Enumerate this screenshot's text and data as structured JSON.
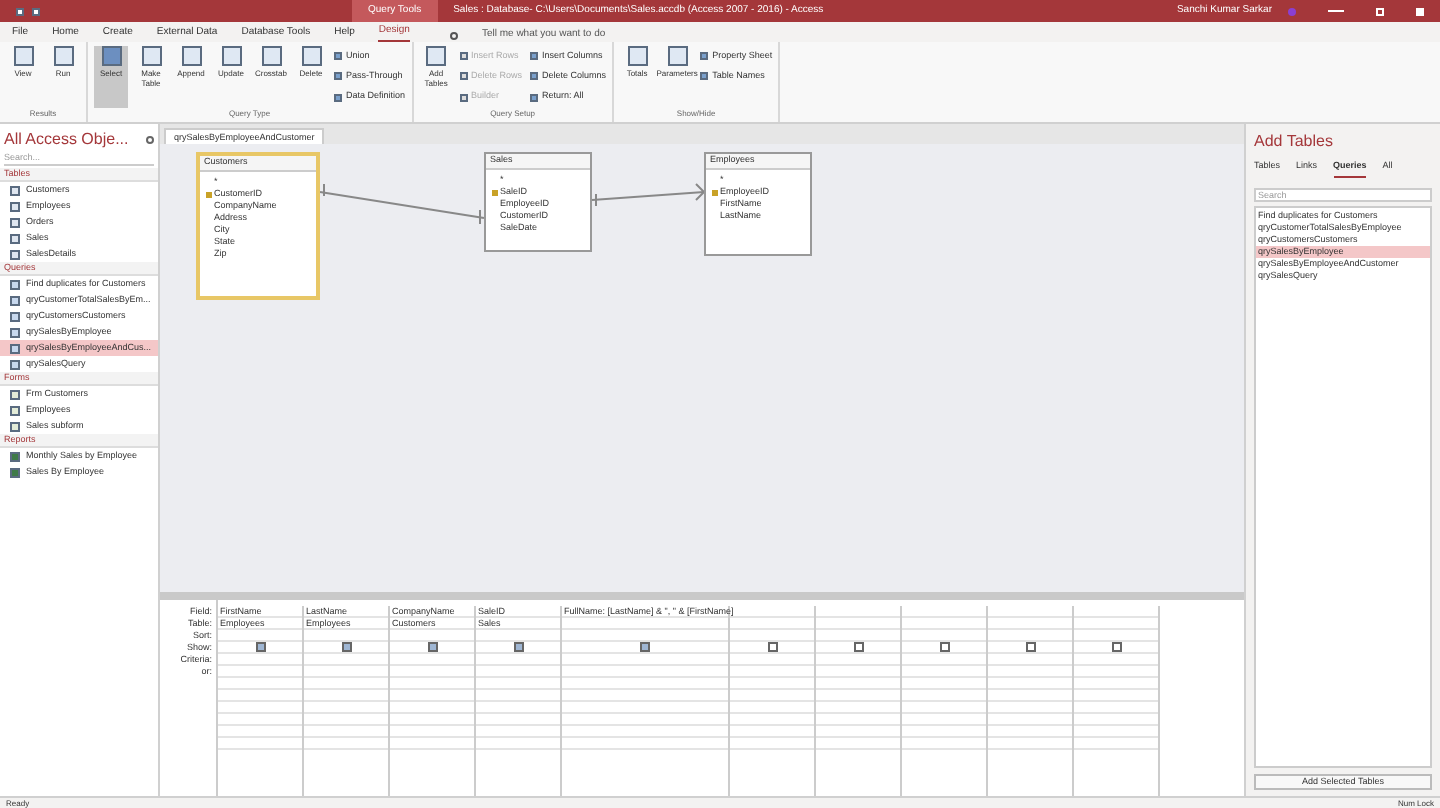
{
  "title_bar": {
    "context": "Query Tools",
    "title": "Sales : Database- C:\\Users\\Documents\\Sales.accdb (Access 2007 - 2016) - Access",
    "user": "Sanchi Kumar Sarkar"
  },
  "ribbon_tabs": [
    {
      "label": "File",
      "selected": false
    },
    {
      "label": "Home",
      "selected": false
    },
    {
      "label": "Create",
      "selected": false
    },
    {
      "label": "External Data",
      "selected": false
    },
    {
      "label": "Database Tools",
      "selected": false
    },
    {
      "label": "Help",
      "selected": false
    },
    {
      "label": "Design",
      "selected": true
    }
  ],
  "tell_me": "Tell me what you want to do",
  "ribbon_groups": [
    {
      "name": "Results",
      "large": [
        {
          "label": "View",
          "selected": false
        },
        {
          "label": "Run",
          "selected": false
        }
      ]
    },
    {
      "name": "Query Type",
      "large": [
        {
          "label": "Select",
          "selected": true
        },
        {
          "label": "Make Table",
          "selected": false
        },
        {
          "label": "Append",
          "selected": false
        },
        {
          "label": "Update",
          "selected": false
        },
        {
          "label": "Crosstab",
          "selected": false
        },
        {
          "label": "Delete",
          "selected": false
        }
      ],
      "small": [
        {
          "label": "Union",
          "disabled": false
        },
        {
          "label": "Pass-Through",
          "disabled": false
        },
        {
          "label": "Data Definition",
          "disabled": false
        }
      ]
    },
    {
      "name": "Query Setup",
      "large": [
        {
          "label": "Add Tables",
          "selected": false
        }
      ],
      "small": [
        {
          "label": "Insert Rows",
          "disabled": true
        },
        {
          "label": "Delete Rows",
          "disabled": true
        },
        {
          "label": "Builder",
          "disabled": true
        },
        {
          "label": "Insert Columns",
          "disabled": false
        },
        {
          "label": "Delete Columns",
          "disabled": false
        },
        {
          "label": "Return: All",
          "disabled": false
        }
      ]
    },
    {
      "name": "Show/Hide",
      "large": [
        {
          "label": "Totals",
          "selected": false
        },
        {
          "label": "Parameters",
          "selected": false
        }
      ],
      "small": [
        {
          "label": "Property Sheet",
          "disabled": false
        },
        {
          "label": "Table Names",
          "disabled": false
        }
      ]
    }
  ],
  "nav": {
    "title": "All Access Obje...",
    "search_placeholder": "Search...",
    "sections": [
      {
        "label": "Tables",
        "kind": "table",
        "items": [
          {
            "label": "Customers",
            "selected": false
          },
          {
            "label": "Employees",
            "selected": false
          },
          {
            "label": "Orders",
            "selected": false
          },
          {
            "label": "Sales",
            "selected": false
          },
          {
            "label": "SalesDetails",
            "selected": false
          }
        ]
      },
      {
        "label": "Queries",
        "kind": "query",
        "items": [
          {
            "label": "Find duplicates for Customers",
            "selected": false
          },
          {
            "label": "qryCustomerTotalSalesByEm...",
            "selected": false
          },
          {
            "label": "qryCustomersCustomers",
            "selected": false
          },
          {
            "label": "qrySalesByEmployee",
            "selected": false
          },
          {
            "label": "qrySalesByEmployeeAndCus...",
            "selected": true
          },
          {
            "label": "qrySalesQuery",
            "selected": false
          }
        ]
      },
      {
        "label": "Forms",
        "kind": "form",
        "items": [
          {
            "label": "Frm Customers",
            "selected": false
          },
          {
            "label": "Employees",
            "selected": false
          },
          {
            "label": "Sales subform",
            "selected": false
          }
        ]
      },
      {
        "label": "Reports",
        "kind": "report",
        "items": [
          {
            "label": "Monthly Sales by Employee",
            "selected": false
          },
          {
            "label": "Sales By Employee",
            "selected": false
          }
        ]
      }
    ]
  },
  "document_tab": "qrySalesByEmployeeAndCustomer",
  "tables": [
    {
      "title": "Customers",
      "selected": true,
      "fields": [
        {
          "name": "*",
          "key": false
        },
        {
          "name": "CustomerID",
          "key": true
        },
        {
          "name": "CompanyName",
          "key": false
        },
        {
          "name": "Address",
          "key": false
        },
        {
          "name": "City",
          "key": false
        },
        {
          "name": "State",
          "key": false
        },
        {
          "name": "Zip",
          "key": false
        }
      ]
    },
    {
      "title": "Sales",
      "selected": false,
      "fields": [
        {
          "name": "*",
          "key": false
        },
        {
          "name": "SaleID",
          "key": true
        },
        {
          "name": "EmployeeID",
          "key": false
        },
        {
          "name": "CustomerID",
          "key": false
        },
        {
          "name": "SaleDate",
          "key": false
        }
      ]
    },
    {
      "title": "Employees",
      "selected": false,
      "fields": [
        {
          "name": "*",
          "key": false
        },
        {
          "name": "EmployeeID",
          "key": true
        },
        {
          "name": "FirstName",
          "key": false
        },
        {
          "name": "LastName",
          "key": false
        }
      ]
    }
  ],
  "grid": {
    "row_labels": [
      "Field:",
      "Table:",
      "Sort:",
      "Show:",
      "Criteria:",
      "or:"
    ],
    "columns": [
      {
        "field": "FirstName",
        "table": "Employees",
        "show": true
      },
      {
        "field": "LastName",
        "table": "Employees",
        "show": true
      },
      {
        "field": "CompanyName",
        "table": "Customers",
        "show": true
      },
      {
        "field": "SaleID",
        "table": "Sales",
        "show": true
      },
      {
        "field": "FullName: [LastName] & \", \" & [FirstName]",
        "show": true
      },
      {
        "show": false
      },
      {
        "show": false
      },
      {
        "show": false
      },
      {
        "show": false
      },
      {
        "show": false
      }
    ]
  },
  "add_tables": {
    "title": "Add Tables",
    "tabs": [
      {
        "label": "Tables",
        "selected": false
      },
      {
        "label": "Links",
        "selected": false
      },
      {
        "label": "Queries",
        "selected": true
      },
      {
        "label": "All",
        "selected": false
      }
    ],
    "search_placeholder": "Search",
    "items": [
      {
        "label": "Find duplicates for Customers",
        "selected": false
      },
      {
        "label": "qryCustomerTotalSalesByEmployee",
        "selected": false
      },
      {
        "label": "qryCustomersCustomers",
        "selected": false
      },
      {
        "label": "qrySalesByEmployee",
        "selected": true
      },
      {
        "label": "qrySalesByEmployeeAndCustomer",
        "selected": false
      },
      {
        "label": "qrySalesQuery",
        "selected": false
      }
    ],
    "button": "Add Selected Tables"
  },
  "status_bar": {
    "left": "Ready",
    "right": "Num Lock"
  }
}
